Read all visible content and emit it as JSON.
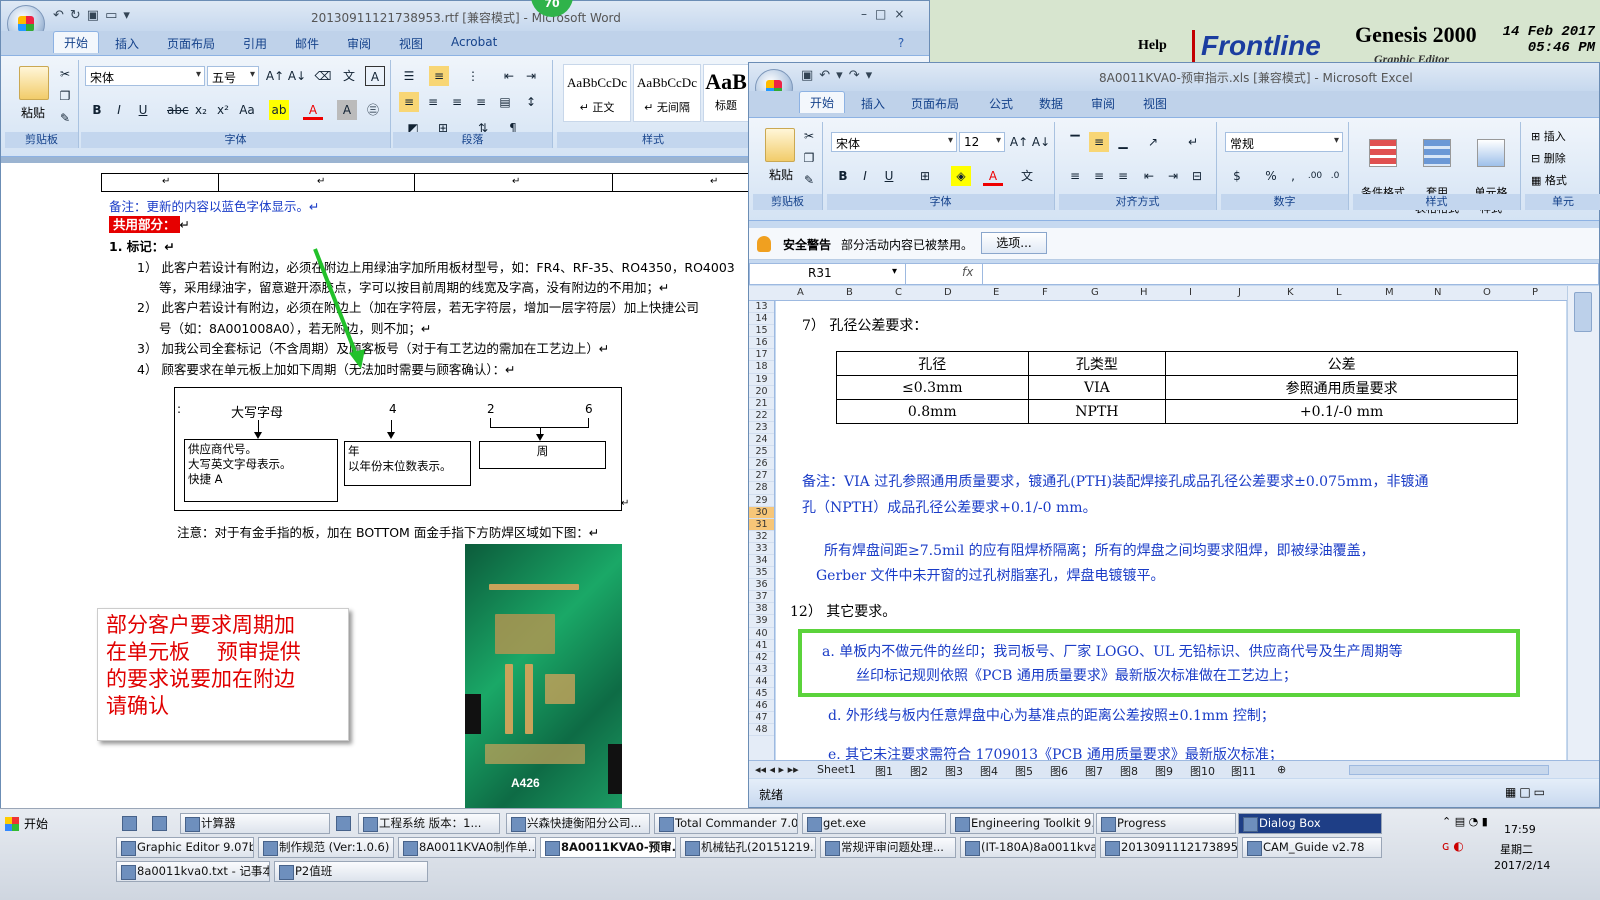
{
  "genesis": {
    "help": "Help",
    "logo": "Frontline",
    "product": "Genesis 2000",
    "subtitle": "Graphic Editor",
    "date": "14 Feb 2017",
    "time": "05:46 PM"
  },
  "word": {
    "title": "20130911121738953.rtf [兼容模式] - Microsoft Word",
    "badge": "70",
    "tabs": [
      "开始",
      "插入",
      "页面布局",
      "引用",
      "邮件",
      "审阅",
      "视图",
      "Acrobat"
    ],
    "groups": {
      "clipboard": "剪贴板",
      "font": "字体",
      "paragraph": "段落",
      "styles": "样式"
    },
    "paste": "粘贴",
    "font_name": "宋体",
    "font_size": "五号",
    "styles": [
      {
        "sample": "AaBbCcDc",
        "name": "↵ 正文"
      },
      {
        "sample": "AaBbCcDc",
        "name": "↵ 无间隔"
      },
      {
        "sample": "AaB",
        "name": "标题"
      }
    ],
    "doc": {
      "table_marks": [
        "↵",
        "↵",
        "↵",
        "↵"
      ],
      "remark": "备注：更新的内容以蓝色字体显示。↵",
      "common": "共用部分：",
      "common_tail": "↵",
      "heading": "1.   标记：↵",
      "items": [
        "1）  此客户若设计有附边，必须在附边上用绿油字加所用板材型号，如：FR4、RF-35、RO4350，RO4003",
        "等，采用绿油字，留意避开添胶点，字可以按目前周期的线宽及字高，没有附边的不用加；↵",
        "2）  此客户若设计有附边，必须在附边上（加在字符层，若无字符层，增加一层字符层）加上快捷公司",
        "号（如：8A001008A0），若无附边，则不加；↵",
        "3）  加我公司全套标记（不含周期）及顾客板号（对于有工艺边的需加在工艺边上）↵",
        "4）  顾客要求在单元板上加如下周期（无法加时需要与顾客确认）：↵"
      ],
      "diagram": {
        "colon": ":",
        "letter_head": "大写字母",
        "four": "4",
        "two": "2",
        "six": "6",
        "box1": [
          "供应商代号。",
          "大写英文字母表示。",
          "快捷  A"
        ],
        "box2": [
          "年",
          "以年份末位数表示。"
        ],
        "box3": "周",
        "tail": "↵"
      },
      "gold_note": "注意：对于有金手指的板，加在 BOTTOM 面金手指下方防焊区域如下图：↵",
      "pcb_label": "A426",
      "red_note": [
        "部分客户要求周期加",
        "在单元板    预审提供",
        "的要求说要加在附边",
        "请确认"
      ]
    }
  },
  "excel": {
    "title": "8A0011KVA0-预审指示.xls [兼容模式] - Microsoft Excel",
    "tabs": [
      "开始",
      "插入",
      "页面布局",
      "公式",
      "数据",
      "审阅",
      "视图"
    ],
    "groups": [
      "剪贴板",
      "字体",
      "对齐方式",
      "数字",
      "样式",
      "单元"
    ],
    "paste": "粘贴",
    "font_name": "宋体",
    "font_size": "12",
    "number_format": "常规",
    "style_btns": [
      "条件格式",
      "套用\n表格格式",
      "单元格\n样式"
    ],
    "cell_btns": [
      "插入",
      "删除",
      "格式"
    ],
    "security": {
      "label": "安全警告",
      "text": "部分活动内容已被禁用。",
      "button": "选项..."
    },
    "name_box": "R31",
    "fx": "fx",
    "columns": [
      "A",
      "B",
      "C",
      "D",
      "E",
      "F",
      "G",
      "H",
      "I",
      "J",
      "K",
      "L",
      "M",
      "N",
      "O",
      "P"
    ],
    "rows": [
      "13",
      "14",
      "15",
      "16",
      "17",
      "18",
      "19",
      "20",
      "21",
      "22",
      "23",
      "24",
      "25",
      "26",
      "27",
      "28",
      "29",
      "30",
      "31",
      "32",
      "33",
      "34",
      "35",
      "36",
      "37",
      "38",
      "39",
      "40",
      "41",
      "42",
      "43",
      "44",
      "45",
      "46",
      "47",
      "48"
    ],
    "selected_rows": [
      "30",
      "31"
    ],
    "content": {
      "hole_title": "7）  孔径公差要求：",
      "table_header": [
        "孔径",
        "孔类型",
        "公差"
      ],
      "table_rows": [
        [
          "≤0.3mm",
          "VIA",
          "参照通用质量要求"
        ],
        [
          "0.8mm",
          "NPTH",
          "+0.1/-0 mm"
        ]
      ],
      "note1": "备注：VIA 过孔参照通用质量要求，镀通孔(PTH)装配焊接孔成品孔径公差要求±0.075mm，非镀通",
      "note2": "孔（NPTH）成品孔径公差要求+0.1/-0    mm。",
      "pad1": "所有焊盘间距≥7.5mil 的应有阻焊桥隔离；所有的焊盘之间均要求阻焊，即被绿油覆盖，",
      "pad2": "Gerber 文件中未开窗的过孔树脂塞孔，焊盘电镀镀平。",
      "other": "12）  其它要求。",
      "a1": "a.     单板内不做元件的丝印；我司板号、厂家 LOGO、UL 无铅标识、供应商代号及生产周期等",
      "a2": "丝印标记规则依照《PCB 通用质量要求》最新版次标准做在工艺边上；",
      "d": "d.     外形线与板内任意焊盘中心为基准点的距离公差按照±0.1mm 控制；",
      "e": "e.     其它未注要求需符合 1709013《PCB 通用质量要求》最新版次标准；"
    },
    "sheet_tabs": [
      "Sheet1",
      "图1",
      "图2",
      "图3",
      "图4",
      "图5",
      "图6",
      "图7",
      "图8",
      "图9",
      "图10",
      "图11"
    ],
    "status": "就绪"
  },
  "taskbar": {
    "start": "开始",
    "row1": [
      "计算器",
      "工程系统  版本：1...",
      "兴森快捷衡阳分公司...",
      "Total Commander 7.0 ...",
      "get.exe",
      "Engineering Toolkit 9....",
      "Progress",
      "Dialog Box"
    ],
    "row2": [
      "Graphic Editor 9.07b...",
      "制作规范 (Ver:1.0.6)",
      "8A0011KVA0制作单...",
      "8A0011KVA0-预审...",
      "机械钻孔(20151219...",
      "常规评审问题处理...",
      "(IT-180A)8a0011kva...",
      "20130911121738953...",
      "CAM_Guide v2.78"
    ],
    "row3": [
      "8a0011kva0.txt - 记事本",
      "P2值班"
    ],
    "clock_time": "17:59",
    "clock_day": "星期二",
    "clock_date": "2017/2/14"
  }
}
